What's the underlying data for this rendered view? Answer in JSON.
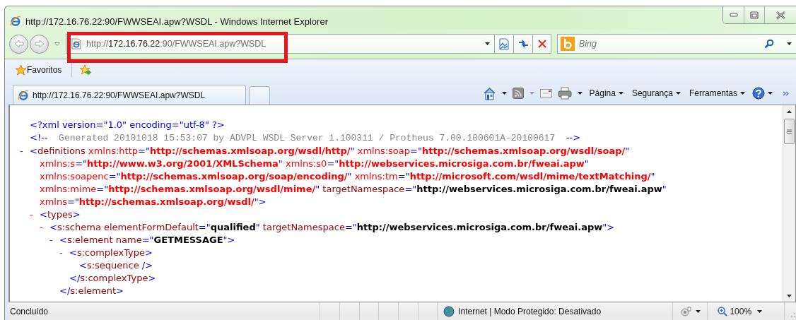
{
  "window": {
    "title": "http://172.16.76.22:90/FWWSEAI.apw?WSDL - Windows Internet Explorer"
  },
  "address_bar": {
    "url_parts": [
      {
        "kind": "dim",
        "text": "http://"
      },
      {
        "kind": "host",
        "text": "172.16.76.22"
      },
      {
        "kind": "dim",
        "text": ":90/FWWSEAI.apw?WSDL"
      }
    ]
  },
  "search": {
    "placeholder": "Bing"
  },
  "favorites": {
    "label": "Favoritos"
  },
  "tabs": [
    {
      "label": "http://172.16.76.22:90/FWWSEAI.apw?WSDL",
      "selected": true
    }
  ],
  "command_bar": {
    "menus": [
      "Página",
      "Segurança",
      "Ferramentas"
    ]
  },
  "document": {
    "nodes": [
      {
        "lines": [
          [
            {
              "kind": "mark",
              "text": "<?xml version=\"1.0\" encoding=\"utf-8\" ?>"
            }
          ]
        ]
      },
      {
        "lines": [
          [
            {
              "kind": "mark",
              "text": "<!--"
            },
            {
              "kind": "comment",
              "text": "  Generated 20101018 15:53:07 by ADVPL WSDL Server 1.100311 / Protheus 7.00.100601A-20100617  "
            },
            {
              "kind": "mark",
              "text": "-->"
            }
          ]
        ]
      },
      {
        "toggle": "-",
        "lines": [
          [
            {
              "kind": "mark",
              "text": "<"
            },
            {
              "kind": "tag",
              "text": "definitions"
            },
            {
              "kind": "ns-attr",
              "text": " xmlns:http"
            },
            {
              "kind": "mark",
              "text": "=\""
            },
            {
              "kind": "ns-value",
              "text": "http://schemas.xmlsoap.org/wsdl/http/"
            },
            {
              "kind": "mark",
              "text": "\""
            },
            {
              "kind": "ns-attr",
              "text": " xmlns:soap"
            },
            {
              "kind": "mark",
              "text": "=\""
            },
            {
              "kind": "ns-value",
              "text": "http://schemas.xmlsoap.org/wsdl/soap/"
            },
            {
              "kind": "mark",
              "text": "\""
            }
          ],
          [
            {
              "kind": "ns-attr",
              "text": "xmlns:s"
            },
            {
              "kind": "mark",
              "text": "=\""
            },
            {
              "kind": "ns-value",
              "text": "http://www.w3.org/2001/XMLSchema"
            },
            {
              "kind": "mark",
              "text": "\""
            },
            {
              "kind": "ns-attr",
              "text": " xmlns:s0"
            },
            {
              "kind": "mark",
              "text": "=\""
            },
            {
              "kind": "ns-value",
              "text": "http://webservices.microsiga.com.br/fweai.apw"
            },
            {
              "kind": "mark",
              "text": "\""
            }
          ],
          [
            {
              "kind": "ns-attr",
              "text": "xmlns:soapenc"
            },
            {
              "kind": "mark",
              "text": "=\""
            },
            {
              "kind": "ns-value",
              "text": "http://schemas.xmlsoap.org/soap/encoding/"
            },
            {
              "kind": "mark",
              "text": "\""
            },
            {
              "kind": "ns-attr",
              "text": " xmlns:tm"
            },
            {
              "kind": "mark",
              "text": "=\""
            },
            {
              "kind": "ns-value",
              "text": "http://microsoft.com/wsdl/mime/textMatching/"
            },
            {
              "kind": "mark",
              "text": "\""
            }
          ],
          [
            {
              "kind": "ns-attr",
              "text": "xmlns:mime"
            },
            {
              "kind": "mark",
              "text": "=\""
            },
            {
              "kind": "ns-value",
              "text": "http://schemas.xmlsoap.org/wsdl/mime/"
            },
            {
              "kind": "mark",
              "text": "\""
            },
            {
              "kind": "attr",
              "text": " targetNamespace"
            },
            {
              "kind": "mark",
              "text": "=\""
            },
            {
              "kind": "value",
              "text": "http://webservices.microsiga.com.br/fweai.apw"
            },
            {
              "kind": "mark",
              "text": "\""
            }
          ],
          [
            {
              "kind": "ns-attr",
              "text": "xmlns"
            },
            {
              "kind": "mark",
              "text": "=\""
            },
            {
              "kind": "ns-value",
              "text": "http://schemas.xmlsoap.org/wsdl/"
            },
            {
              "kind": "mark",
              "text": "\">"
            }
          ]
        ],
        "children": [
          {
            "toggle": "-",
            "lines": [
              [
                {
                  "kind": "mark",
                  "text": "<"
                },
                {
                  "kind": "tag",
                  "text": "types"
                },
                {
                  "kind": "mark",
                  "text": ">"
                }
              ]
            ],
            "children": [
              {
                "toggle": "-",
                "lines": [
                  [
                    {
                      "kind": "mark",
                      "text": "<"
                    },
                    {
                      "kind": "tag",
                      "text": "s:schema"
                    },
                    {
                      "kind": "attr",
                      "text": " elementFormDefault"
                    },
                    {
                      "kind": "mark",
                      "text": "=\""
                    },
                    {
                      "kind": "value",
                      "text": "qualified"
                    },
                    {
                      "kind": "mark",
                      "text": "\""
                    },
                    {
                      "kind": "attr",
                      "text": " targetNamespace"
                    },
                    {
                      "kind": "mark",
                      "text": "=\""
                    },
                    {
                      "kind": "value",
                      "text": "http://webservices.microsiga.com.br/fweai.apw"
                    },
                    {
                      "kind": "mark",
                      "text": "\">"
                    }
                  ]
                ],
                "children": [
                  {
                    "toggle": "-",
                    "lines": [
                      [
                        {
                          "kind": "mark",
                          "text": "<"
                        },
                        {
                          "kind": "tag",
                          "text": "s:element"
                        },
                        {
                          "kind": "attr",
                          "text": " name"
                        },
                        {
                          "kind": "mark",
                          "text": "=\""
                        },
                        {
                          "kind": "value",
                          "text": "GETMESSAGE"
                        },
                        {
                          "kind": "mark",
                          "text": "\">"
                        }
                      ]
                    ],
                    "children": [
                      {
                        "toggle": "-",
                        "lines": [
                          [
                            {
                              "kind": "mark",
                              "text": "<"
                            },
                            {
                              "kind": "tag",
                              "text": "s:complexType"
                            },
                            {
                              "kind": "mark",
                              "text": ">"
                            }
                          ]
                        ],
                        "children": [
                          {
                            "lines": [
                              [
                                {
                                  "kind": "mark",
                                  "text": "<"
                                },
                                {
                                  "kind": "tag",
                                  "text": "s:sequence"
                                },
                                {
                                  "kind": "mark",
                                  "text": " />"
                                }
                              ]
                            ]
                          }
                        ],
                        "closing": [
                          {
                            "kind": "mark",
                            "text": "</"
                          },
                          {
                            "kind": "tag",
                            "text": "s:complexType"
                          },
                          {
                            "kind": "mark",
                            "text": ">"
                          }
                        ]
                      }
                    ],
                    "closing": [
                      {
                        "kind": "mark",
                        "text": "</"
                      },
                      {
                        "kind": "tag",
                        "text": "s:element"
                      },
                      {
                        "kind": "mark",
                        "text": ">"
                      }
                    ]
                  }
                ]
              }
            ]
          }
        ]
      }
    ]
  },
  "status_bar": {
    "status": "Concluído",
    "zone": "Internet | Modo Protegido: Desativado",
    "zoom": "100%"
  }
}
